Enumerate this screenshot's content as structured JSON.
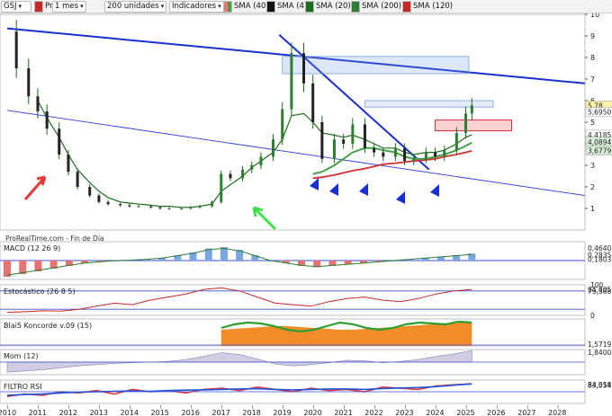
{
  "toolbar": {
    "symbol": "GSJ",
    "price_label": "Precio",
    "sma_labels": [
      "SMA (40)",
      "SMA (4)",
      "SMA (20)",
      "SMA (200)",
      "SMA (120)"
    ],
    "period": "1 mes",
    "units": "200 unidades",
    "indicators": "Indicadores",
    "colors": {
      "price": "#c62828",
      "sma40": "#d32f2f",
      "sma4": "#111111",
      "sma20": "#1b6d1b",
      "sma200": "#2e7d32",
      "sma120": "#c62828"
    }
  },
  "source_label": "ProRealTime.com - Fin de Día",
  "chart_data": [
    {
      "type": "line",
      "title": "GSJ",
      "x": [
        2010.0,
        2010.3,
        2010.7,
        2011.0,
        2011.3,
        2011.7,
        2012.0,
        2012.3,
        2012.7,
        2013.0,
        2013.3,
        2013.7,
        2014.0,
        2014.3,
        2014.7,
        2015.0,
        2015.3,
        2015.7,
        2016.0,
        2016.3,
        2016.7,
        2017.0,
        2017.3,
        2017.7,
        2018.0,
        2018.3,
        2018.7,
        2019.0,
        2019.3,
        2019.7,
        2020.0,
        2020.3,
        2020.7,
        2021.0,
        2021.3,
        2021.7,
        2022.0,
        2022.3,
        2022.7,
        2023.0,
        2023.3,
        2023.7,
        2024.0,
        2024.3,
        2024.7,
        2025.0,
        2025.2
      ],
      "series": [
        {
          "values": [
            9.2,
            7.5,
            6.2,
            5.5,
            4.7,
            3.5,
            2.7,
            2.0,
            1.6,
            1.3,
            1.2,
            1.15,
            1.1,
            1.1,
            1.05,
            1.0,
            1.0,
            1.0,
            1.05,
            1.1,
            1.3,
            2.6,
            2.4,
            2.8,
            3.0,
            3.4,
            4.2,
            5.6,
            8.2,
            6.8,
            5.0,
            3.3,
            4.2,
            4.0,
            4.9,
            3.8,
            3.6,
            3.4,
            3.8,
            3.2,
            3.3,
            3.6,
            3.4,
            3.7,
            4.5,
            5.4,
            5.78
          ]
        },
        {
          "values": [
            null,
            null,
            null,
            null,
            null,
            null,
            null,
            null,
            null,
            null,
            null,
            null,
            null,
            null,
            null,
            null,
            null,
            null,
            null,
            null,
            null,
            null,
            null,
            null,
            null,
            null,
            null,
            null,
            null,
            null,
            2.4,
            2.45,
            2.55,
            2.65,
            2.75,
            2.85,
            2.95,
            3.05,
            3.1,
            3.15,
            3.2,
            3.25,
            3.3,
            3.4,
            3.5,
            3.6,
            3.67
          ]
        },
        {
          "values": [
            null,
            null,
            null,
            null,
            null,
            null,
            null,
            null,
            null,
            null,
            null,
            null,
            null,
            null,
            null,
            null,
            null,
            null,
            null,
            null,
            null,
            null,
            null,
            null,
            null,
            null,
            null,
            null,
            null,
            null,
            2.6,
            2.7,
            3.0,
            3.3,
            3.6,
            3.8,
            3.8,
            3.7,
            3.6,
            3.4,
            3.3,
            3.3,
            3.4,
            3.5,
            3.7,
            3.9,
            4.05
          ]
        },
        {
          "values": [
            null,
            null,
            null,
            6.0,
            5.2,
            4.3,
            3.5,
            2.8,
            2.2,
            1.8,
            1.5,
            1.3,
            1.25,
            1.2,
            1.15,
            1.1,
            1.1,
            1.05,
            1.05,
            1.1,
            1.2,
            1.8,
            2.1,
            2.5,
            2.9,
            3.2,
            3.6,
            4.2,
            5.3,
            5.4,
            5.0,
            4.5,
            4.4,
            4.3,
            4.4,
            4.2,
            4.0,
            3.8,
            3.8,
            3.6,
            3.5,
            3.6,
            3.6,
            3.7,
            4.0,
            4.3,
            4.42
          ]
        },
        {
          "values": [
            null,
            null,
            null,
            null,
            null,
            null,
            null,
            null,
            null,
            null,
            null,
            null,
            null,
            null,
            null,
            null,
            null,
            null,
            null,
            null,
            null,
            null,
            null,
            null,
            null,
            null,
            null,
            null,
            null,
            null,
            null,
            null,
            null,
            null,
            null,
            null,
            null,
            null,
            null,
            null,
            null,
            null,
            null,
            null,
            null,
            null,
            null
          ]
        }
      ],
      "ylim": [
        0,
        10
      ],
      "y_ticks": [
        1,
        2,
        3,
        4,
        5,
        6,
        7,
        8,
        9,
        10
      ],
      "x_ticks": [
        "2010",
        "2011",
        "2012",
        "2013",
        "2014",
        "2015",
        "2016",
        "2017",
        "2018",
        "2019",
        "2020",
        "2021",
        "2022",
        "2023",
        "2024",
        "2025",
        "2026",
        "2027",
        "2028"
      ],
      "price_tags": [
        {
          "text": "5,78",
          "value": 5.78,
          "bg": "#fff3b0"
        },
        {
          "text": "5,6950",
          "value": 5.47,
          "bg": "#ffffff"
        },
        {
          "text": "4,4185",
          "value": 4.42,
          "bg": "#ffffff"
        },
        {
          "text": "4,0894",
          "value": 4.09,
          "bg": "#d9f0d9"
        },
        {
          "text": "3,6779",
          "value": 3.68,
          "bg": "#d9f0d9"
        }
      ]
    },
    {
      "type": "bar",
      "title": "MACD (12 26 9)",
      "x_start": 2010.0,
      "x_end": 2025.2,
      "values": [
        -0.6,
        -0.5,
        -0.4,
        -0.3,
        -0.2,
        -0.1,
        -0.05,
        0,
        0.02,
        0.05,
        0.1,
        0.2,
        0.3,
        0.45,
        0.5,
        0.4,
        0.2,
        0,
        -0.1,
        -0.2,
        -0.25,
        -0.2,
        -0.15,
        -0.1,
        -0.05,
        0,
        0.05,
        0.1,
        0.15,
        0.2,
        0.26
      ],
      "ylim": [
        -0.7,
        0.7
      ],
      "tags": [
        {
          "text": "0,4640",
          "value": 0.46
        },
        {
          "text": "0,2835",
          "value": 0.28
        },
        {
          "text": "0,1803",
          "value": 0.18
        }
      ]
    },
    {
      "type": "line",
      "title": "Estocástico (26 8 5)",
      "x_start": 2010.0,
      "x_end": 2025.2,
      "series": [
        {
          "values": [
            10,
            12,
            15,
            14,
            20,
            30,
            40,
            35,
            50,
            60,
            70,
            85,
            90,
            80,
            60,
            40,
            35,
            30,
            45,
            55,
            60,
            50,
            45,
            55,
            70,
            80,
            84.9
          ]
        }
      ],
      "ylim": [
        0,
        100
      ],
      "ref_lines": [
        80,
        20
      ],
      "y_ticks": [
        100,
        0
      ],
      "tags": [
        {
          "text": "84,805",
          "value": 84.805
        },
        {
          "text": "79,388",
          "value": 79.388
        }
      ]
    },
    {
      "type": "area",
      "title": "Blai5 Koncorde v.09 (15)",
      "x_start": 2017.0,
      "x_end": 2025.2,
      "series": [
        {
          "values": [
            18,
            19,
            20,
            21,
            22,
            22,
            21,
            20,
            19,
            18,
            18,
            19,
            20,
            21,
            22,
            23,
            24,
            25,
            26,
            27
          ]
        },
        {
          "values": [
            20,
            24,
            26,
            25,
            22,
            18,
            16,
            18,
            22,
            26,
            24,
            20,
            18,
            20,
            24,
            26,
            25,
            24,
            27,
            26
          ]
        }
      ],
      "ylim": [
        0,
        30
      ],
      "tags": [
        {
          "text": "1,5719",
          "value": 2.0
        }
      ]
    },
    {
      "type": "area",
      "title": "Mom (12)",
      "x_start": 2010.0,
      "x_end": 2025.2,
      "series": [
        {
          "values": [
            -1.6,
            -1.4,
            -1.2,
            -0.9,
            -0.6,
            -0.4,
            -0.2,
            -0.1,
            0,
            0.1,
            0.4,
            0.9,
            1.5,
            1.2,
            0.5,
            -0.3,
            -0.6,
            -0.4,
            -0.1,
            0.3,
            0.2,
            -0.1,
            0.1,
            0.4,
            0.9,
            1.3,
            1.84
          ]
        }
      ],
      "ylim": [
        -2,
        2
      ],
      "tags": [
        {
          "text": "1,8400",
          "value": 1.84
        }
      ]
    },
    {
      "type": "line",
      "title": "FILTRO RSI",
      "x_start": 2010.0,
      "x_end": 2025.2,
      "series": [
        {
          "values": [
            30,
            40,
            35,
            50,
            45,
            55,
            40,
            60,
            50,
            55,
            45,
            60,
            65,
            55,
            70,
            60,
            50,
            65,
            55,
            60,
            50,
            70,
            65,
            60,
            75,
            80,
            84
          ]
        },
        {
          "values": [
            35,
            38,
            40,
            45,
            48,
            50,
            52,
            54,
            52,
            55,
            57,
            58,
            60,
            62,
            63,
            60,
            58,
            60,
            62,
            62,
            60,
            64,
            66,
            68,
            72,
            78,
            83.5
          ]
        }
      ],
      "ylim": [
        0,
        100
      ],
      "tags": [
        {
          "text": "84,018",
          "value": 84.018
        },
        {
          "text": "83,554",
          "value": 83.554
        }
      ]
    }
  ]
}
